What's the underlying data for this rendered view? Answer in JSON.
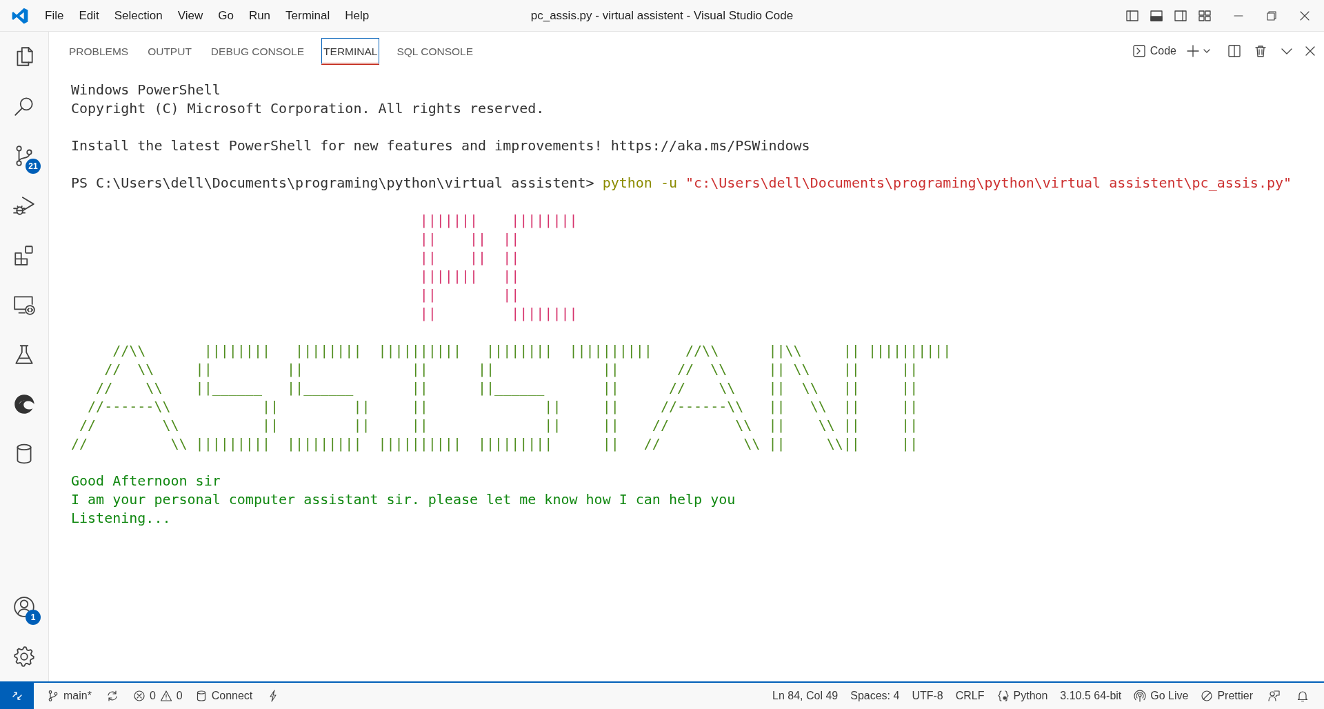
{
  "window": {
    "title": "pc_assis.py - virtual assistent - Visual Studio Code",
    "menu": [
      "File",
      "Edit",
      "Selection",
      "View",
      "Go",
      "Run",
      "Terminal",
      "Help"
    ]
  },
  "activity_bar": {
    "items": [
      {
        "kind": "explorer"
      },
      {
        "kind": "search"
      },
      {
        "kind": "source-control",
        "badge": "21"
      },
      {
        "kind": "run-debug"
      },
      {
        "kind": "extensions"
      },
      {
        "kind": "remote"
      },
      {
        "kind": "testing"
      },
      {
        "kind": "edge"
      },
      {
        "kind": "database"
      }
    ],
    "bottom": [
      {
        "kind": "account",
        "badge": "1"
      },
      {
        "kind": "settings"
      }
    ]
  },
  "panel": {
    "tabs": [
      {
        "label": "PROBLEMS",
        "selected": false
      },
      {
        "label": "OUTPUT",
        "selected": false
      },
      {
        "label": "DEBUG CONSOLE",
        "selected": false
      },
      {
        "label": "TERMINAL",
        "selected": true
      },
      {
        "label": "SQL CONSOLE",
        "selected": false
      }
    ],
    "terminal_name": "Code"
  },
  "terminal": {
    "intro": [
      "Windows PowerShell",
      "Copyright (C) Microsoft Corporation. All rights reserved."
    ],
    "notice": "Install the latest PowerShell for new features and improvements! https://aka.ms/PSWindows",
    "prompt": "PS C:\\Users\\dell\\Documents\\programing\\python\\virtual assistent>",
    "command": "python -u",
    "argument": "\"c:\\Users\\dell\\Documents\\programing\\python\\virtual assistent\\pc_assis.py\"",
    "art": [
      {
        "kind": "pc",
        "lines": [
          "|||||||    ||||||||",
          "||    ||  ||",
          "||    ||  ||",
          "|||||||   ||",
          "||        ||",
          "||         ||||||||"
        ]
      },
      {
        "kind": "assistant",
        "lines": [
          "     //\\\\       ||||||||   ||||||||  ||||||||||   ||||||||  ||||||||||    //\\\\      ||\\\\     || ||||||||||",
          "    //  \\\\     ||         ||             ||      ||             ||       //  \\\\     || \\\\    ||     ||",
          "   //    \\\\    ||______   ||______       ||      ||______       ||      //    \\\\    ||  \\\\   ||     ||",
          "  //------\\\\           ||         ||     ||              ||     ||     //------\\\\   ||   \\\\  ||     ||",
          " //        \\\\          ||         ||     ||              ||     ||    //        \\\\  ||    \\\\ ||     ||",
          "//          \\\\ |||||||||  |||||||||  ||||||||||  |||||||||      ||   //          \\\\ ||     \\\\||     ||"
        ]
      }
    ],
    "output": [
      "Good Afternoon sir",
      "I am your personal computer assistant sir. please let me know how I can help you",
      "Listening..."
    ]
  },
  "status_bar": {
    "branch": "main*",
    "errors": "0",
    "warnings": "0",
    "connect": "Connect",
    "position": "Ln 84, Col 49",
    "indentation": "Spaces: 4",
    "encoding": "UTF-8",
    "line_ending": "CRLF",
    "language": "Python",
    "interpreter": "3.10.5 64-bit",
    "live_server": "Go Live",
    "formatter": "Prettier"
  }
}
